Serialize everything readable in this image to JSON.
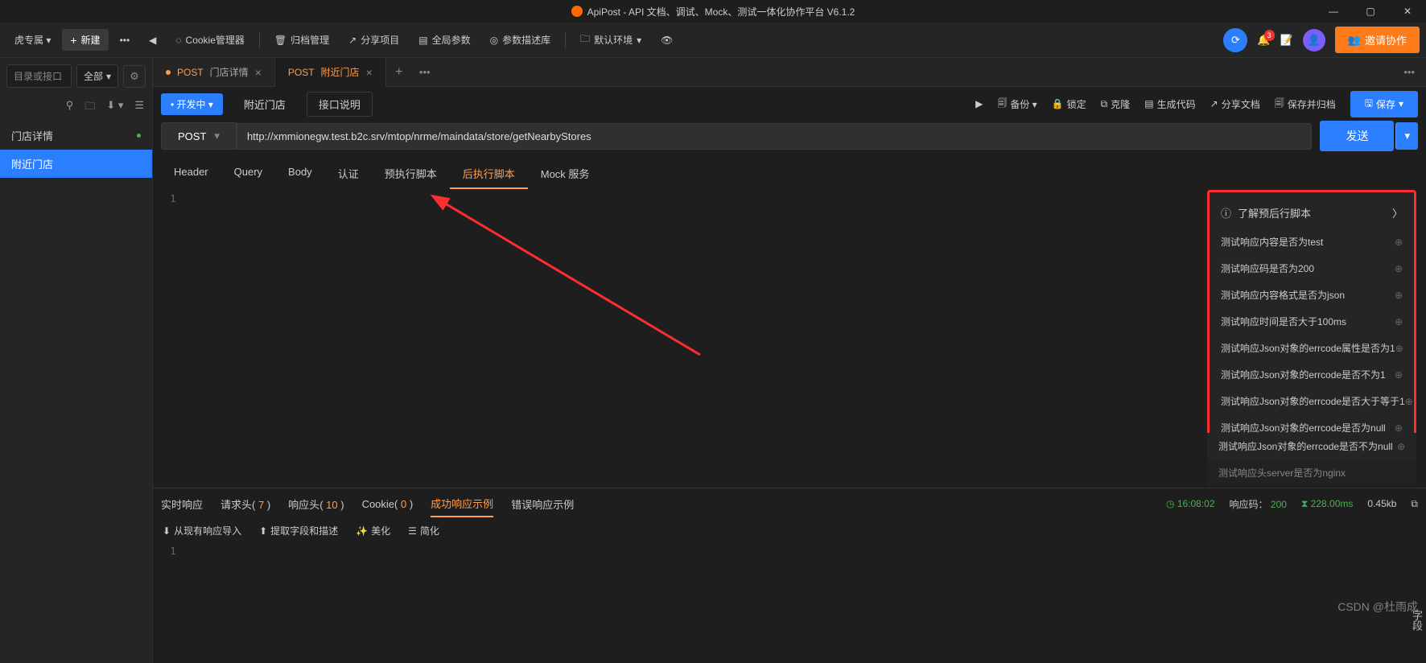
{
  "app": {
    "title": "ApiPost - API 文档、调试、Mock、测试一体化协作平台 V6.1.2"
  },
  "toolbar": {
    "team": "虎专属 ▾",
    "new": "新建",
    "cookie": "Cookie管理器",
    "archive": "归档管理",
    "share": "分享项目",
    "global": "全局参数",
    "paramlib": "参数描述库",
    "env": "默认环境",
    "invite": "邀请协作"
  },
  "sidebar": {
    "search_placeholder": "目录或接口",
    "filter": "全部",
    "items": [
      {
        "label": "门店详情",
        "active": false,
        "dot": true
      },
      {
        "label": "附近门店",
        "active": true,
        "dot": false
      }
    ]
  },
  "tabs": [
    {
      "method": "POST",
      "label": "门店详情",
      "active": false
    },
    {
      "method": "POST",
      "label": "附近门店",
      "active": true
    }
  ],
  "actionbar": {
    "status": "• 开发中 ▾",
    "name": "附近门店",
    "desc": "接口说明",
    "items": [
      "备份 ▾",
      "锁定",
      "克隆",
      "生成代码",
      "分享文档",
      "保存并归档"
    ],
    "save": "保存"
  },
  "request": {
    "method": "POST",
    "url": "http://xmmionegw.test.b2c.srv/mtop/nrme/maindata/store/getNearbyStores",
    "send": "发送"
  },
  "req_tabs": [
    "Header",
    "Query",
    "Body",
    "认证",
    "预执行脚本",
    "后执行脚本",
    "Mock 服务"
  ],
  "req_tab_active": "后执行脚本",
  "snippets": {
    "header": "了解预后行脚本",
    "highlighted": [
      "测试响应内容是否为test",
      "测试响应码是否为200",
      "测试响应内容格式是否为json",
      "测试响应时间是否大于100ms",
      "测试响应Json对象的errcode属性是否为1",
      "测试响应Json对象的errcode是否不为1",
      "测试响应Json对象的errcode是否大于等于1",
      "测试响应Json对象的errcode是否为null"
    ],
    "extra": [
      "测试响应Json对象的errcode是否不为null",
      "测试响应头server是否为nginx"
    ]
  },
  "response": {
    "tabs": {
      "realtime": "实时响应",
      "reqhead": "请求头",
      "reqhead_n": "7",
      "resphead": "响应头",
      "resphead_n": "10",
      "cookie": "Cookie",
      "cookie_n": "0",
      "success": "成功响应示例",
      "error": "错误响应示例"
    },
    "stats": {
      "time": "16:08:02",
      "code_label": "响应码：",
      "code": "200",
      "dur": "228.00ms",
      "size": "0.45kb"
    },
    "tools": [
      "从现有响应导入",
      "提取字段和描述",
      "美化",
      "简化"
    ]
  },
  "watermark": "CSDN @杜雨成",
  "wm_vert": "字段"
}
